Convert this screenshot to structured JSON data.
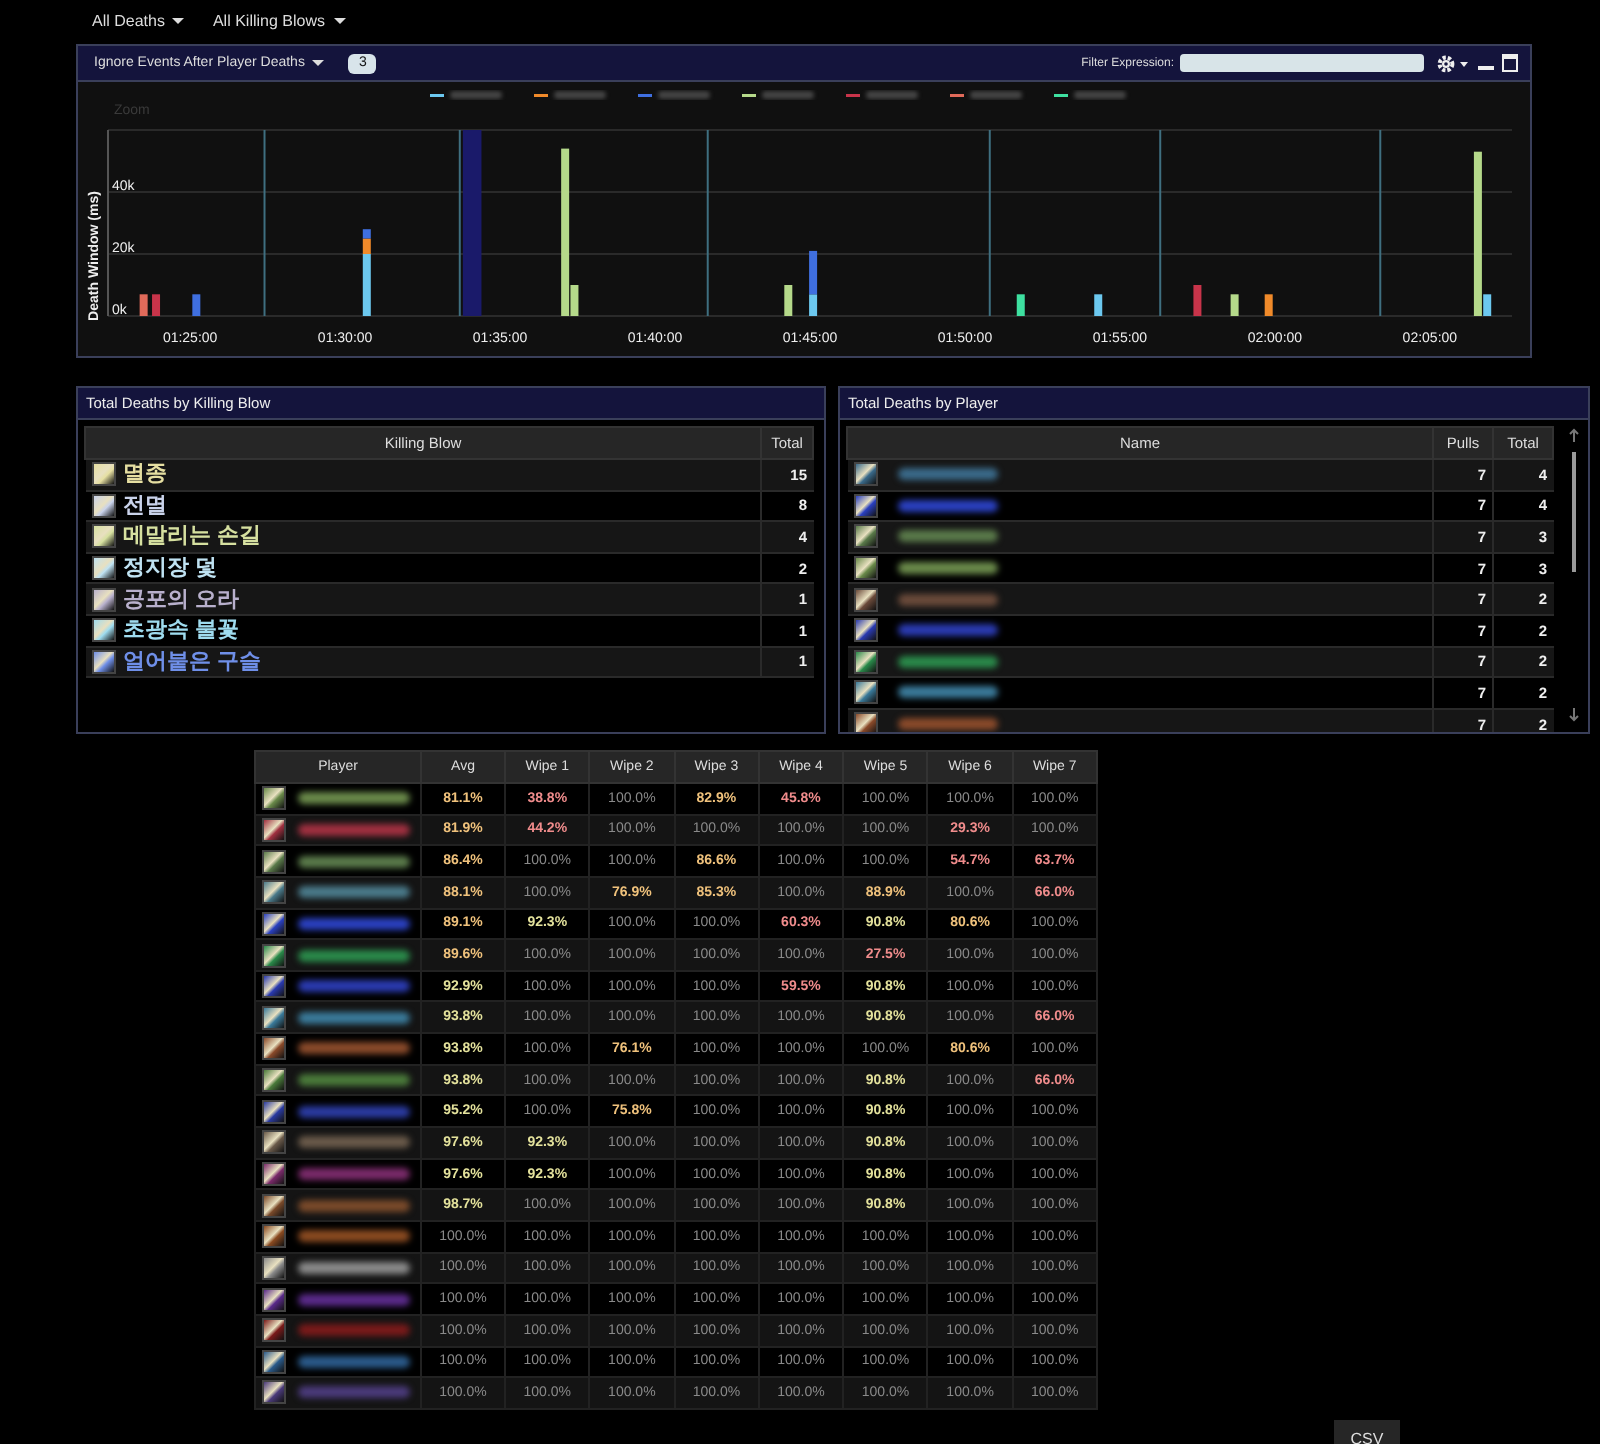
{
  "menu": [
    {
      "label": "All Deaths"
    },
    {
      "label": "All Killing Blows"
    }
  ],
  "chart_panel": {
    "dropdown": {
      "label": "Ignore Events After Player Deaths"
    },
    "count_field": {
      "value": "3"
    },
    "filter": {
      "label": "Filter Expression:"
    },
    "zoom_label": "Zoom",
    "chart_data": {
      "type": "bar",
      "stacked": true,
      "ylabel": "Death Window (ms)",
      "x": [
        83.5,
        83.9,
        85.2,
        90.7,
        97.1,
        97.4,
        104.3,
        105.1,
        111.8,
        114.3,
        117.5,
        118.7,
        119.8,
        126.55,
        126.85
      ],
      "series": [
        {
          "color": "#6cc8ef",
          "values": [
            null,
            null,
            null,
            20000,
            null,
            null,
            null,
            7000,
            null,
            7000,
            null,
            null,
            null,
            null,
            7000
          ]
        },
        {
          "color": "#f08a2a",
          "values": [
            null,
            null,
            null,
            5000,
            null,
            null,
            null,
            null,
            null,
            null,
            null,
            null,
            7000,
            null,
            null
          ]
        },
        {
          "color": "#3f6fe0",
          "values": [
            null,
            null,
            7000,
            3000,
            null,
            null,
            null,
            14000,
            null,
            null,
            null,
            null,
            null,
            null,
            null
          ]
        },
        {
          "color": "#b5d98a",
          "values": [
            null,
            null,
            null,
            null,
            54000,
            10000,
            10000,
            null,
            null,
            null,
            null,
            7000,
            null,
            53000,
            null
          ]
        },
        {
          "color": "#c8344a",
          "values": [
            null,
            7000,
            null,
            null,
            null,
            null,
            null,
            null,
            null,
            null,
            10000,
            null,
            null,
            null,
            null
          ]
        },
        {
          "color": "#e06a5a",
          "values": [
            7000,
            null,
            null,
            null,
            null,
            null,
            null,
            null,
            null,
            null,
            null,
            null,
            null,
            null,
            null
          ]
        },
        {
          "color": "#3ee0a0",
          "values": [
            null,
            null,
            null,
            null,
            null,
            null,
            null,
            null,
            7000,
            null,
            null,
            null,
            null,
            null,
            null
          ]
        }
      ],
      "xlim": [
        82.35,
        127.65
      ],
      "ylim": [
        0,
        60000
      ],
      "xticks": [
        {
          "value": 85,
          "label": "01:25:00"
        },
        {
          "value": 90,
          "label": "01:30:00"
        },
        {
          "value": 95,
          "label": "01:35:00"
        },
        {
          "value": 100,
          "label": "01:40:00"
        },
        {
          "value": 105,
          "label": "01:45:00"
        },
        {
          "value": 110,
          "label": "01:50:00"
        },
        {
          "value": 115,
          "label": "01:55:00"
        },
        {
          "value": 120,
          "label": "02:00:00"
        },
        {
          "value": 125,
          "label": "02:05:00"
        }
      ],
      "yticks": [
        {
          "value": 0,
          "label": "0k"
        },
        {
          "value": 20000,
          "label": "20k"
        },
        {
          "value": 40000,
          "label": "40k"
        }
      ],
      "bands": [
        {
          "axis": "x",
          "from": 93.8,
          "to": 94.4
        }
      ],
      "ref_lines": [
        {
          "axis": "x",
          "value": 87.4
        },
        {
          "axis": "x",
          "value": 93.7
        },
        {
          "axis": "x",
          "value": 101.7
        },
        {
          "axis": "x",
          "value": 110.8
        },
        {
          "axis": "x",
          "value": 116.3
        },
        {
          "axis": "x",
          "value": 123.4
        }
      ]
    }
  },
  "killing_blows": {
    "title": "Total Deaths by Killing Blow",
    "columns": [
      "Killing Blow",
      "Total"
    ],
    "rows": [
      {
        "name": "멸종",
        "total": "15",
        "color": "#e6dfa2"
      },
      {
        "name": "전멸",
        "total": "8",
        "color": "#c9d2ea"
      },
      {
        "name": "메말리는 손길",
        "total": "4",
        "color": "#d6e0a0"
      },
      {
        "name": "정지장 덫",
        "total": "2",
        "color": "#bfe2f2"
      },
      {
        "name": "공포의 오라",
        "total": "1",
        "color": "#b8b0cc"
      },
      {
        "name": "초광속 불꽃",
        "total": "1",
        "color": "#9fdcef"
      },
      {
        "name": "얼어붙은 구슬",
        "total": "1",
        "color": "#6f8fe8"
      }
    ]
  },
  "players": {
    "title": "Total Deaths by Player",
    "columns": [
      "Name",
      "Pulls",
      "Total"
    ],
    "rows": [
      {
        "color": "#3a6a8a",
        "pulls": "7",
        "total": "4"
      },
      {
        "color": "#2a40c0",
        "pulls": "7",
        "total": "4"
      },
      {
        "color": "#5a7a4a",
        "pulls": "7",
        "total": "3"
      },
      {
        "color": "#6a8a4a",
        "pulls": "7",
        "total": "3"
      },
      {
        "color": "#6a4a3a",
        "pulls": "7",
        "total": "2"
      },
      {
        "color": "#2a3ab0",
        "pulls": "7",
        "total": "2"
      },
      {
        "color": "#2a8a4a",
        "pulls": "7",
        "total": "2"
      },
      {
        "color": "#3a7a9a",
        "pulls": "7",
        "total": "2"
      },
      {
        "color": "#8a4a2a",
        "pulls": "7",
        "total": "2"
      }
    ]
  },
  "wipe_table": {
    "player_column": "Player",
    "columns": [
      "Avg",
      "Wipe 1",
      "Wipe 2",
      "Wipe 3",
      "Wipe 4",
      "Wipe 5",
      "Wipe 6",
      "Wipe 7"
    ],
    "rows": [
      {
        "color": "#6a8a4a",
        "cells": [
          {
            "text": "81.1%",
            "color": "#f0c27c"
          },
          {
            "text": "38.8%",
            "color": "#f08c8c"
          },
          {
            "text": "100.0%",
            "color": "#8a8a8a"
          },
          {
            "text": "82.9%",
            "color": "#f0c27c"
          },
          {
            "text": "45.8%",
            "color": "#f08c8c"
          },
          {
            "text": "100.0%",
            "color": "#8a8a8a"
          },
          {
            "text": "100.0%",
            "color": "#8a8a8a"
          },
          {
            "text": "100.0%",
            "color": "#8a8a8a"
          }
        ]
      },
      {
        "color": "#a03040",
        "cells": [
          {
            "text": "81.9%",
            "color": "#f0c27c"
          },
          {
            "text": "44.2%",
            "color": "#f08c8c"
          },
          {
            "text": "100.0%",
            "color": "#8a8a8a"
          },
          {
            "text": "100.0%",
            "color": "#8a8a8a"
          },
          {
            "text": "100.0%",
            "color": "#8a8a8a"
          },
          {
            "text": "100.0%",
            "color": "#8a8a8a"
          },
          {
            "text": "29.3%",
            "color": "#f08c8c"
          },
          {
            "text": "100.0%",
            "color": "#8a8a8a"
          }
        ]
      },
      {
        "color": "#5a7a4a",
        "cells": [
          {
            "text": "86.4%",
            "color": "#f0c27c"
          },
          {
            "text": "100.0%",
            "color": "#8a8a8a"
          },
          {
            "text": "100.0%",
            "color": "#8a8a8a"
          },
          {
            "text": "86.6%",
            "color": "#f0c27c"
          },
          {
            "text": "100.0%",
            "color": "#8a8a8a"
          },
          {
            "text": "100.0%",
            "color": "#8a8a8a"
          },
          {
            "text": "54.7%",
            "color": "#f08c8c"
          },
          {
            "text": "63.7%",
            "color": "#f08c8c"
          }
        ]
      },
      {
        "color": "#4a7a8a",
        "cells": [
          {
            "text": "88.1%",
            "color": "#f0c27c"
          },
          {
            "text": "100.0%",
            "color": "#8a8a8a"
          },
          {
            "text": "76.9%",
            "color": "#f0c27c"
          },
          {
            "text": "85.3%",
            "color": "#f0c27c"
          },
          {
            "text": "100.0%",
            "color": "#8a8a8a"
          },
          {
            "text": "88.9%",
            "color": "#f0c27c"
          },
          {
            "text": "100.0%",
            "color": "#8a8a8a"
          },
          {
            "text": "66.0%",
            "color": "#f08c8c"
          }
        ]
      },
      {
        "color": "#2a40c0",
        "cells": [
          {
            "text": "89.1%",
            "color": "#f0c27c"
          },
          {
            "text": "92.3%",
            "color": "#e4e29c"
          },
          {
            "text": "100.0%",
            "color": "#8a8a8a"
          },
          {
            "text": "100.0%",
            "color": "#8a8a8a"
          },
          {
            "text": "60.3%",
            "color": "#f08c8c"
          },
          {
            "text": "90.8%",
            "color": "#e4e29c"
          },
          {
            "text": "80.6%",
            "color": "#f0c27c"
          },
          {
            "text": "100.0%",
            "color": "#8a8a8a"
          }
        ]
      },
      {
        "color": "#2a8a4a",
        "cells": [
          {
            "text": "89.6%",
            "color": "#f0c27c"
          },
          {
            "text": "100.0%",
            "color": "#8a8a8a"
          },
          {
            "text": "100.0%",
            "color": "#8a8a8a"
          },
          {
            "text": "100.0%",
            "color": "#8a8a8a"
          },
          {
            "text": "100.0%",
            "color": "#8a8a8a"
          },
          {
            "text": "27.5%",
            "color": "#f08c8c"
          },
          {
            "text": "100.0%",
            "color": "#8a8a8a"
          },
          {
            "text": "100.0%",
            "color": "#8a8a8a"
          }
        ]
      },
      {
        "color": "#2a3ab0",
        "cells": [
          {
            "text": "92.9%",
            "color": "#e4e29c"
          },
          {
            "text": "100.0%",
            "color": "#8a8a8a"
          },
          {
            "text": "100.0%",
            "color": "#8a8a8a"
          },
          {
            "text": "100.0%",
            "color": "#8a8a8a"
          },
          {
            "text": "59.5%",
            "color": "#f08c8c"
          },
          {
            "text": "90.8%",
            "color": "#e4e29c"
          },
          {
            "text": "100.0%",
            "color": "#8a8a8a"
          },
          {
            "text": "100.0%",
            "color": "#8a8a8a"
          }
        ]
      },
      {
        "color": "#3a7a9a",
        "cells": [
          {
            "text": "93.8%",
            "color": "#e4e29c"
          },
          {
            "text": "100.0%",
            "color": "#8a8a8a"
          },
          {
            "text": "100.0%",
            "color": "#8a8a8a"
          },
          {
            "text": "100.0%",
            "color": "#8a8a8a"
          },
          {
            "text": "100.0%",
            "color": "#8a8a8a"
          },
          {
            "text": "90.8%",
            "color": "#e4e29c"
          },
          {
            "text": "100.0%",
            "color": "#8a8a8a"
          },
          {
            "text": "66.0%",
            "color": "#f08c8c"
          }
        ]
      },
      {
        "color": "#8a4a2a",
        "cells": [
          {
            "text": "93.8%",
            "color": "#e4e29c"
          },
          {
            "text": "100.0%",
            "color": "#8a8a8a"
          },
          {
            "text": "76.1%",
            "color": "#f0c27c"
          },
          {
            "text": "100.0%",
            "color": "#8a8a8a"
          },
          {
            "text": "100.0%",
            "color": "#8a8a8a"
          },
          {
            "text": "100.0%",
            "color": "#8a8a8a"
          },
          {
            "text": "80.6%",
            "color": "#f0c27c"
          },
          {
            "text": "100.0%",
            "color": "#8a8a8a"
          }
        ]
      },
      {
        "color": "#4a7a3a",
        "cells": [
          {
            "text": "93.8%",
            "color": "#e4e29c"
          },
          {
            "text": "100.0%",
            "color": "#8a8a8a"
          },
          {
            "text": "100.0%",
            "color": "#8a8a8a"
          },
          {
            "text": "100.0%",
            "color": "#8a8a8a"
          },
          {
            "text": "100.0%",
            "color": "#8a8a8a"
          },
          {
            "text": "90.8%",
            "color": "#e4e29c"
          },
          {
            "text": "100.0%",
            "color": "#8a8a8a"
          },
          {
            "text": "66.0%",
            "color": "#f08c8c"
          }
        ]
      },
      {
        "color": "#2a3aa0",
        "cells": [
          {
            "text": "95.2%",
            "color": "#e4e29c"
          },
          {
            "text": "100.0%",
            "color": "#8a8a8a"
          },
          {
            "text": "75.8%",
            "color": "#f0c27c"
          },
          {
            "text": "100.0%",
            "color": "#8a8a8a"
          },
          {
            "text": "100.0%",
            "color": "#8a8a8a"
          },
          {
            "text": "90.8%",
            "color": "#e4e29c"
          },
          {
            "text": "100.0%",
            "color": "#8a8a8a"
          },
          {
            "text": "100.0%",
            "color": "#8a8a8a"
          }
        ]
      },
      {
        "color": "#6a5a4a",
        "cells": [
          {
            "text": "97.6%",
            "color": "#e4e29c"
          },
          {
            "text": "92.3%",
            "color": "#e4e29c"
          },
          {
            "text": "100.0%",
            "color": "#8a8a8a"
          },
          {
            "text": "100.0%",
            "color": "#8a8a8a"
          },
          {
            "text": "100.0%",
            "color": "#8a8a8a"
          },
          {
            "text": "90.8%",
            "color": "#e4e29c"
          },
          {
            "text": "100.0%",
            "color": "#8a8a8a"
          },
          {
            "text": "100.0%",
            "color": "#8a8a8a"
          }
        ]
      },
      {
        "color": "#7a2a6a",
        "cells": [
          {
            "text": "97.6%",
            "color": "#e4e29c"
          },
          {
            "text": "92.3%",
            "color": "#e4e29c"
          },
          {
            "text": "100.0%",
            "color": "#8a8a8a"
          },
          {
            "text": "100.0%",
            "color": "#8a8a8a"
          },
          {
            "text": "100.0%",
            "color": "#8a8a8a"
          },
          {
            "text": "90.8%",
            "color": "#e4e29c"
          },
          {
            "text": "100.0%",
            "color": "#8a8a8a"
          },
          {
            "text": "100.0%",
            "color": "#8a8a8a"
          }
        ]
      },
      {
        "color": "#7a4a2a",
        "cells": [
          {
            "text": "98.7%",
            "color": "#e4e29c"
          },
          {
            "text": "100.0%",
            "color": "#8a8a8a"
          },
          {
            "text": "100.0%",
            "color": "#8a8a8a"
          },
          {
            "text": "100.0%",
            "color": "#8a8a8a"
          },
          {
            "text": "100.0%",
            "color": "#8a8a8a"
          },
          {
            "text": "90.8%",
            "color": "#e4e29c"
          },
          {
            "text": "100.0%",
            "color": "#8a8a8a"
          },
          {
            "text": "100.0%",
            "color": "#8a8a8a"
          }
        ]
      },
      {
        "color": "#8a4a20",
        "cells": [
          {
            "text": "100.0%",
            "color": "#8a8a8a"
          },
          {
            "text": "100.0%",
            "color": "#8a8a8a"
          },
          {
            "text": "100.0%",
            "color": "#8a8a8a"
          },
          {
            "text": "100.0%",
            "color": "#8a8a8a"
          },
          {
            "text": "100.0%",
            "color": "#8a8a8a"
          },
          {
            "text": "100.0%",
            "color": "#8a8a8a"
          },
          {
            "text": "100.0%",
            "color": "#8a8a8a"
          },
          {
            "text": "100.0%",
            "color": "#8a8a8a"
          }
        ]
      },
      {
        "color": "#8a8a8a",
        "cells": [
          {
            "text": "100.0%",
            "color": "#8a8a8a"
          },
          {
            "text": "100.0%",
            "color": "#8a8a8a"
          },
          {
            "text": "100.0%",
            "color": "#8a8a8a"
          },
          {
            "text": "100.0%",
            "color": "#8a8a8a"
          },
          {
            "text": "100.0%",
            "color": "#8a8a8a"
          },
          {
            "text": "100.0%",
            "color": "#8a8a8a"
          },
          {
            "text": "100.0%",
            "color": "#8a8a8a"
          },
          {
            "text": "100.0%",
            "color": "#8a8a8a"
          }
        ]
      },
      {
        "color": "#5a2a8a",
        "cells": [
          {
            "text": "100.0%",
            "color": "#8a8a8a"
          },
          {
            "text": "100.0%",
            "color": "#8a8a8a"
          },
          {
            "text": "100.0%",
            "color": "#8a8a8a"
          },
          {
            "text": "100.0%",
            "color": "#8a8a8a"
          },
          {
            "text": "100.0%",
            "color": "#8a8a8a"
          },
          {
            "text": "100.0%",
            "color": "#8a8a8a"
          },
          {
            "text": "100.0%",
            "color": "#8a8a8a"
          },
          {
            "text": "100.0%",
            "color": "#8a8a8a"
          }
        ]
      },
      {
        "color": "#7a1a1a",
        "cells": [
          {
            "text": "100.0%",
            "color": "#8a8a8a"
          },
          {
            "text": "100.0%",
            "color": "#8a8a8a"
          },
          {
            "text": "100.0%",
            "color": "#8a8a8a"
          },
          {
            "text": "100.0%",
            "color": "#8a8a8a"
          },
          {
            "text": "100.0%",
            "color": "#8a8a8a"
          },
          {
            "text": "100.0%",
            "color": "#8a8a8a"
          },
          {
            "text": "100.0%",
            "color": "#8a8a8a"
          },
          {
            "text": "100.0%",
            "color": "#8a8a8a"
          }
        ]
      },
      {
        "color": "#2a5a8a",
        "cells": [
          {
            "text": "100.0%",
            "color": "#8a8a8a"
          },
          {
            "text": "100.0%",
            "color": "#8a8a8a"
          },
          {
            "text": "100.0%",
            "color": "#8a8a8a"
          },
          {
            "text": "100.0%",
            "color": "#8a8a8a"
          },
          {
            "text": "100.0%",
            "color": "#8a8a8a"
          },
          {
            "text": "100.0%",
            "color": "#8a8a8a"
          },
          {
            "text": "100.0%",
            "color": "#8a8a8a"
          },
          {
            "text": "100.0%",
            "color": "#8a8a8a"
          }
        ]
      },
      {
        "color": "#4a3a7a",
        "cells": [
          {
            "text": "100.0%",
            "color": "#8a8a8a"
          },
          {
            "text": "100.0%",
            "color": "#8a8a8a"
          },
          {
            "text": "100.0%",
            "color": "#8a8a8a"
          },
          {
            "text": "100.0%",
            "color": "#8a8a8a"
          },
          {
            "text": "100.0%",
            "color": "#8a8a8a"
          },
          {
            "text": "100.0%",
            "color": "#8a8a8a"
          },
          {
            "text": "100.0%",
            "color": "#8a8a8a"
          },
          {
            "text": "100.0%",
            "color": "#8a8a8a"
          }
        ]
      }
    ]
  },
  "csv_button": {
    "label": "CSV"
  }
}
